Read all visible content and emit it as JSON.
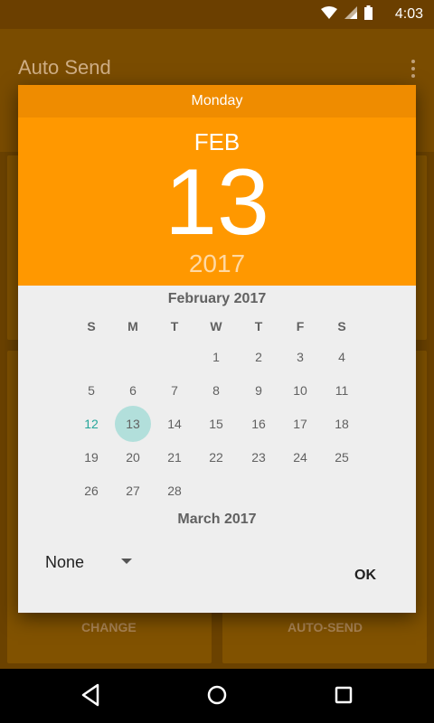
{
  "status_bar": {
    "time": "4:03",
    "icons": [
      "wifi-icon",
      "signal-icon",
      "battery-icon"
    ]
  },
  "app_bar": {
    "title": "Auto Send",
    "more_icon": "more-vert-icon"
  },
  "background": {
    "buttons": [
      "CHANGE",
      "AUTO-SEND"
    ]
  },
  "dialog": {
    "header": {
      "day_of_week": "Monday",
      "month": "FEB",
      "date": "13",
      "year": "2017"
    },
    "calendar": {
      "month_title": "February 2017",
      "weekdays": [
        "S",
        "M",
        "T",
        "W",
        "T",
        "F",
        "S"
      ],
      "days": [
        "1",
        "2",
        "3",
        "4",
        "5",
        "6",
        "7",
        "8",
        "9",
        "10",
        "11",
        "12",
        "13",
        "14",
        "15",
        "16",
        "17",
        "18",
        "19",
        "20",
        "21",
        "22",
        "23",
        "24",
        "25",
        "26",
        "27",
        "28"
      ],
      "today": "12",
      "selected": "13",
      "next_month_title": "March 2017"
    },
    "footer": {
      "repeat_value": "None",
      "ok_label": "OK"
    }
  },
  "colors": {
    "accent": "#ff9800",
    "accent_dark": "#ef8c00",
    "selected_day_bg": "#b2dfdb",
    "today_text": "#26a69a"
  }
}
